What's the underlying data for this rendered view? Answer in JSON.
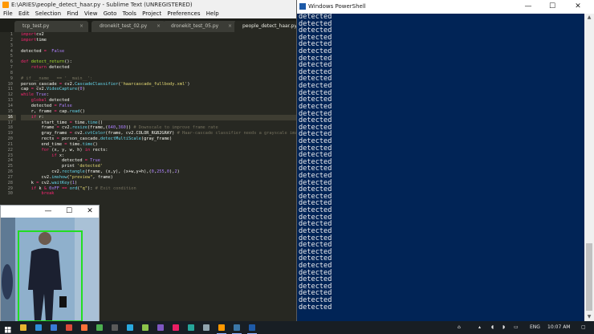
{
  "sublime": {
    "title": "E:\\ARIES\\people_detect_haar.py - Sublime Text (UNREGISTERED)",
    "menu": [
      "File",
      "Edit",
      "Selection",
      "Find",
      "View",
      "Goto",
      "Tools",
      "Project",
      "Preferences",
      "Help"
    ],
    "tabs": [
      {
        "label": "tcp_test.py",
        "active": false
      },
      {
        "label": "dronekit_test_02.py",
        "active": false
      },
      {
        "label": "dronekit_test_05.py",
        "active": false
      },
      {
        "label": "people_detect_haar.py",
        "active": true
      }
    ],
    "tab_close_glyph": "×",
    "current_line": 16,
    "code_lines": [
      [
        [
          "kw",
          "import"
        ],
        [
          "",
          "cv2"
        ]
      ],
      [
        [
          "kw",
          "import"
        ],
        [
          "",
          "time"
        ]
      ],
      [],
      [
        [
          "",
          "detected "
        ],
        [
          "kw",
          "="
        ],
        [
          "",
          "  "
        ],
        [
          "nm",
          "False"
        ]
      ],
      [],
      [
        [
          "kw",
          "def "
        ],
        [
          "fn",
          "detect_return"
        ],
        [
          "",
          "():"
        ]
      ],
      [
        [
          "",
          ""
        ],
        [
          "kw",
          "    return"
        ],
        [
          "",
          " detected"
        ]
      ],
      [],
      [
        [
          "cm",
          "# if __name__ == '__main__':"
        ]
      ],
      [
        [
          "",
          "person_cascade "
        ],
        [
          "kw",
          "="
        ],
        [
          "",
          " cv2."
        ],
        [
          "bi",
          "CascadeClassifier"
        ],
        [
          "",
          "("
        ],
        [
          "st",
          "'haarcascade_fullbody.xml'"
        ],
        [
          "",
          ")"
        ]
      ],
      [
        [
          "",
          "cap "
        ],
        [
          "kw",
          "="
        ],
        [
          "",
          " cv2."
        ],
        [
          "bi",
          "VideoCapture"
        ],
        [
          "",
          "("
        ],
        [
          "nm",
          "0"
        ],
        [
          "",
          ")"
        ]
      ],
      [
        [
          "kw",
          "while "
        ],
        [
          "nm",
          "True"
        ],
        [
          "",
          ":"
        ]
      ],
      [
        [
          "kw",
          "    global"
        ],
        [
          "",
          " detected"
        ]
      ],
      [
        [
          "",
          "    detected "
        ],
        [
          "kw",
          "="
        ],
        [
          "",
          " "
        ],
        [
          "nm",
          "False"
        ]
      ],
      [
        [
          "",
          "    r, frame "
        ],
        [
          "kw",
          "="
        ],
        [
          "",
          " cap."
        ],
        [
          "bi",
          "read"
        ],
        [
          "",
          "()"
        ]
      ],
      [
        [
          "kw",
          "    if"
        ],
        [
          "",
          " r:"
        ]
      ],
      [
        [
          "",
          "        start_time "
        ],
        [
          "kw",
          "="
        ],
        [
          "",
          " time."
        ],
        [
          "bi",
          "time"
        ],
        [
          "",
          "()"
        ]
      ],
      [
        [
          "",
          "        frame "
        ],
        [
          "kw",
          "="
        ],
        [
          "",
          " cv2."
        ],
        [
          "bi",
          "resize"
        ],
        [
          "",
          "(frame,("
        ],
        [
          "nm",
          "640"
        ],
        [
          "",
          ","
        ],
        [
          "nm",
          "360"
        ],
        [
          "",
          ")) "
        ],
        [
          "cm",
          "# Downscale to improve frame rate"
        ]
      ],
      [
        [
          "",
          "        gray_frame "
        ],
        [
          "kw",
          "="
        ],
        [
          "",
          " cv2."
        ],
        [
          "bi",
          "cvtColor"
        ],
        [
          "",
          "(frame, cv2.COLOR_RGB2GRAY) "
        ],
        [
          "cm",
          "# Haar-cascade classifier needs a grayscale image"
        ]
      ],
      [
        [
          "",
          "        rects "
        ],
        [
          "kw",
          "="
        ],
        [
          "",
          " person_cascade."
        ],
        [
          "bi",
          "detectMultiScale"
        ],
        [
          "",
          "(gray_frame)"
        ]
      ],
      [
        [
          "",
          "        end_time "
        ],
        [
          "kw",
          "="
        ],
        [
          "",
          " time."
        ],
        [
          "bi",
          "time"
        ],
        [
          "",
          "()"
        ]
      ],
      [
        [
          "kw",
          "        for"
        ],
        [
          "",
          " (x, y, w, h) "
        ],
        [
          "kw",
          "in"
        ],
        [
          "",
          " rects:"
        ]
      ],
      [
        [
          "kw",
          "            if"
        ],
        [
          "",
          " x:"
        ]
      ],
      [
        [
          "",
          "                detected "
        ],
        [
          "kw",
          "="
        ],
        [
          "",
          " "
        ],
        [
          "nm",
          "True"
        ]
      ],
      [
        [
          "",
          "                print "
        ],
        [
          "st",
          "'detected'"
        ]
      ],
      [
        [
          "",
          "            cv2."
        ],
        [
          "bi",
          "rectangle"
        ],
        [
          "",
          "(frame, (x,y), (x+w,y+h),("
        ],
        [
          "nm",
          "0"
        ],
        [
          "",
          ","
        ],
        [
          "nm",
          "255"
        ],
        [
          "",
          ","
        ],
        [
          "nm",
          "0"
        ],
        [
          "",
          "),"
        ],
        [
          "nm",
          "2"
        ],
        [
          "",
          ")"
        ]
      ],
      [
        [
          "",
          "        cv2."
        ],
        [
          "bi",
          "imshow"
        ],
        [
          "",
          "("
        ],
        [
          "st",
          "\"preview\""
        ],
        [
          "",
          ", frame)"
        ]
      ],
      [
        [
          "",
          "    k "
        ],
        [
          "kw",
          "="
        ],
        [
          "",
          " cv2."
        ],
        [
          "bi",
          "waitKey"
        ],
        [
          "",
          "("
        ],
        [
          "nm",
          "1"
        ],
        [
          "",
          ")"
        ]
      ],
      [
        [
          "kw",
          "    if"
        ],
        [
          "",
          " k "
        ],
        [
          "kw",
          "&"
        ],
        [
          "",
          " "
        ],
        [
          "nm",
          "0xFF"
        ],
        [
          "",
          " "
        ],
        [
          "kw",
          "=="
        ],
        [
          "",
          " "
        ],
        [
          "bi",
          "ord"
        ],
        [
          "",
          "("
        ],
        [
          "st",
          "\"q\""
        ],
        [
          "",
          "): "
        ],
        [
          "cm",
          "# Exit condition"
        ]
      ],
      [
        [
          "kw",
          "        break"
        ]
      ]
    ]
  },
  "video_window": {
    "minimize": "—",
    "maximize": "☐",
    "close": "✕",
    "detection_color": "#22dd22"
  },
  "powershell": {
    "title": "Windows PowerShell",
    "minimize": "—",
    "maximize": "☐",
    "close": "✕",
    "scroll_up": "▲",
    "scroll_down": "▼",
    "output_line": "detected",
    "output_line_count": 43
  },
  "taskbar": {
    "start_icon": "windows-logo-icon",
    "pinned": [
      {
        "name": "file-explorer-icon",
        "color": "#e8b530",
        "active": false
      },
      {
        "name": "edge-icon",
        "color": "#2f8fd8",
        "active": false
      },
      {
        "name": "store-icon",
        "color": "#3a7bd5",
        "active": false
      },
      {
        "name": "chrome-icon",
        "color": "#dd4b39",
        "active": false
      },
      {
        "name": "firefox-icon",
        "color": "#ff7139",
        "active": false
      },
      {
        "name": "app-icon",
        "color": "#4caf50",
        "active": false
      },
      {
        "name": "terminal-icon",
        "color": "#5a5a5a",
        "active": false
      },
      {
        "name": "app-icon",
        "color": "#29a9e0",
        "active": false
      },
      {
        "name": "app-icon",
        "color": "#8bc34a",
        "active": false
      },
      {
        "name": "app-icon",
        "color": "#7e57c2",
        "active": false
      },
      {
        "name": "app-icon",
        "color": "#e91e63",
        "active": false
      },
      {
        "name": "app-icon",
        "color": "#26a69a",
        "active": false
      },
      {
        "name": "app-icon",
        "color": "#90a4ae",
        "active": false
      },
      {
        "name": "sublime-text-icon",
        "color": "#ff9800",
        "active": true
      },
      {
        "name": "python-icon",
        "color": "#3b77a8",
        "active": true
      },
      {
        "name": "powershell-icon",
        "color": "#1e5aa8",
        "active": true
      }
    ],
    "language": "ENG",
    "time": "10:07 AM"
  }
}
